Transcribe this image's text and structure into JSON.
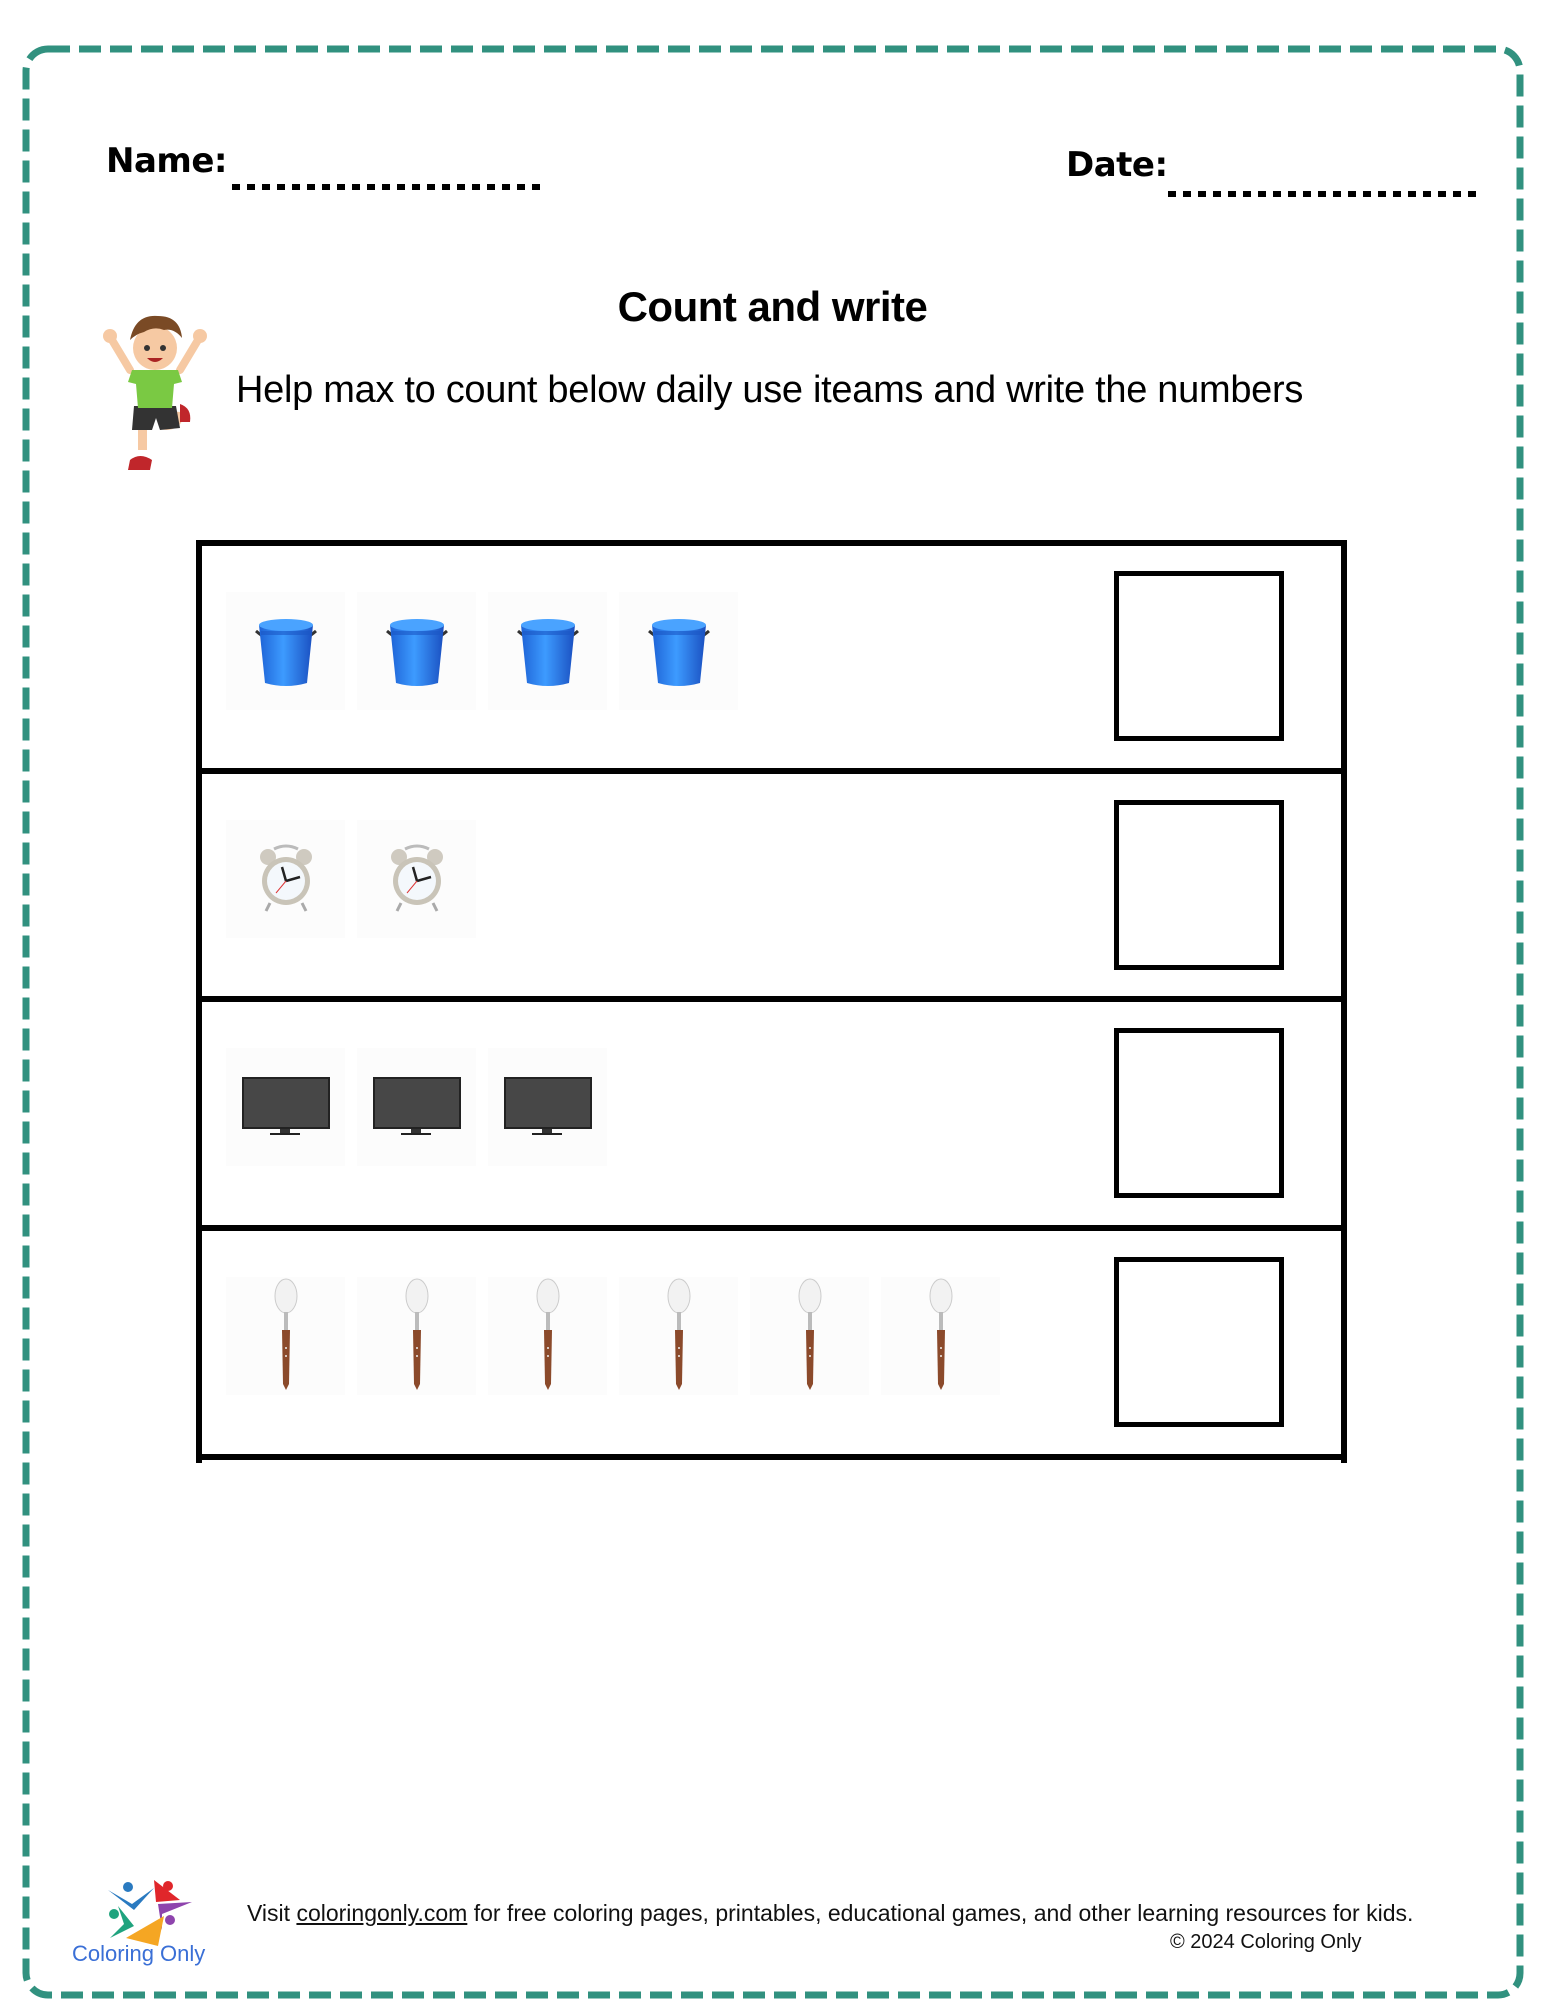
{
  "header": {
    "name_label": "Name:",
    "date_label": "Date:"
  },
  "title": "Count and write",
  "instruction": "Help max to count below daily use iteams and write the numbers",
  "mascot": "boy-character-illustration",
  "rows": [
    {
      "item": "bucket",
      "icon": "bucket-icon",
      "count": 4,
      "answer": ""
    },
    {
      "item": "alarm clock",
      "icon": "alarm-clock-icon",
      "count": 2,
      "answer": ""
    },
    {
      "item": "monitor",
      "icon": "monitor-icon",
      "count": 3,
      "answer": ""
    },
    {
      "item": "spoon",
      "icon": "spoon-icon",
      "count": 6,
      "answer": ""
    }
  ],
  "footer": {
    "logo_text": "Coloring Only",
    "visit_prefix": "Visit ",
    "link_text": "coloringonly.com",
    "visit_suffix": " for free coloring pages, printables, educational games, and other learning resources for kids.",
    "copyright": "© 2024 Coloring Only"
  },
  "colors": {
    "border": "#31917f",
    "bucket": "#2f7fe8",
    "logo_text": "#3a6fd6"
  }
}
